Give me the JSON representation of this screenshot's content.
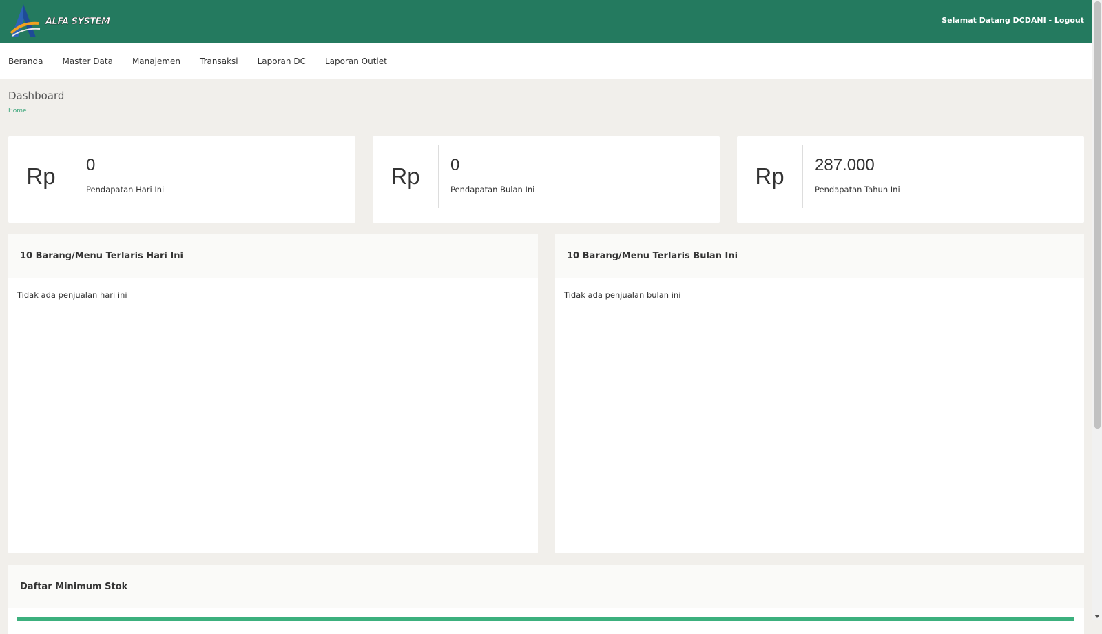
{
  "header": {
    "logo_text": "ALFA SYSTEM",
    "welcome": "Selamat Datang DCDANI - Logout",
    "brand_color": "#247a5f"
  },
  "nav": {
    "items": [
      "Beranda",
      "Master Data",
      "Manajemen",
      "Transaksi",
      "Laporan DC",
      "Laporan Outlet"
    ]
  },
  "page": {
    "title": "Dashboard",
    "breadcrumb": "Home"
  },
  "stats": [
    {
      "currency": "Rp",
      "value": "0",
      "label": "Pendapatan Hari Ini"
    },
    {
      "currency": "Rp",
      "value": "0",
      "label": "Pendapatan Bulan Ini"
    },
    {
      "currency": "Rp",
      "value": "287.000",
      "label": "Pendapatan Tahun Ini"
    }
  ],
  "panels": {
    "today": {
      "title": "10 Barang/Menu Terlaris Hari Ini",
      "empty_text": "Tidak ada penjualan hari ini"
    },
    "month": {
      "title": "10 Barang/Menu Terlaris Bulan Ini",
      "empty_text": "Tidak ada penjualan bulan ini"
    },
    "min_stock": {
      "title": "Daftar Minimum Stok"
    }
  },
  "colors": {
    "accent_green": "#3cb07e",
    "breadcrumb_green": "#3aa57a"
  }
}
